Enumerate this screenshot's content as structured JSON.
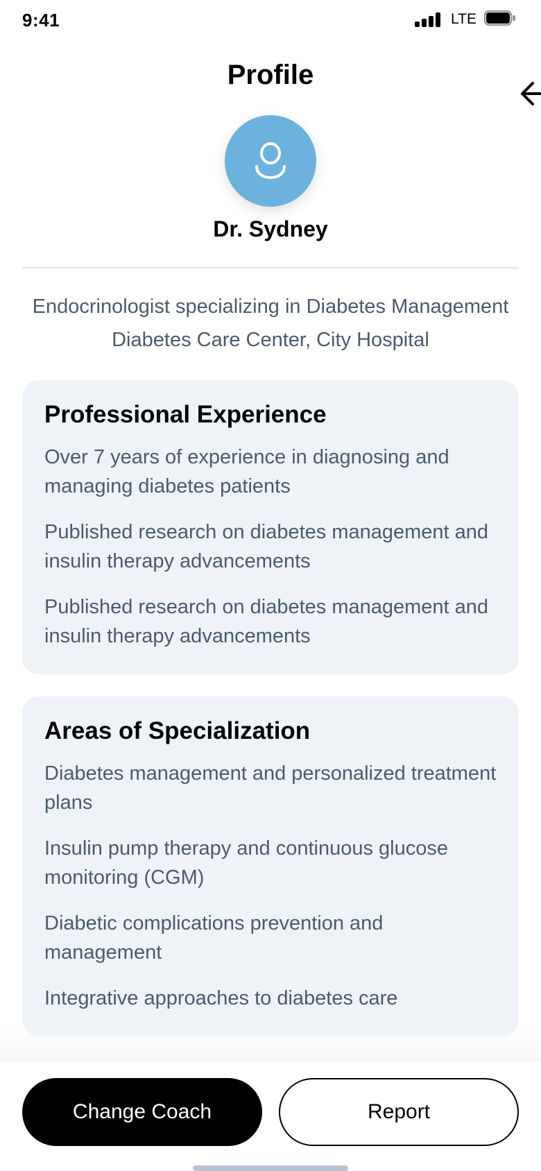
{
  "status_bar": {
    "time": "9:41",
    "network": "LTE"
  },
  "header": {
    "title": "Profile"
  },
  "profile": {
    "name": "Dr. Sydney",
    "specialty": "Endocrinologist specializing in Diabetes Management",
    "workplace": "Diabetes Care Center, City Hospital"
  },
  "experience": {
    "title": "Professional Experience",
    "items": [
      "Over 7 years of experience in diagnosing and managing diabetes patients",
      "Published research on diabetes management and insulin therapy advancements",
      "Published research on diabetes management and insulin therapy advancements"
    ]
  },
  "specialization": {
    "title": "Areas of Specialization",
    "items": [
      "Diabetes management and personalized treatment plans",
      "Insulin pump therapy and continuous glucose monitoring (CGM)",
      "Diabetic complications prevention and management",
      "Integrative approaches to diabetes care"
    ]
  },
  "actions": {
    "change_coach": "Change Coach",
    "report": "Report"
  },
  "colors": {
    "avatar": "#6cb2dc",
    "card_background": "#eff3f8",
    "secondary_text": "#4b5a6e"
  }
}
